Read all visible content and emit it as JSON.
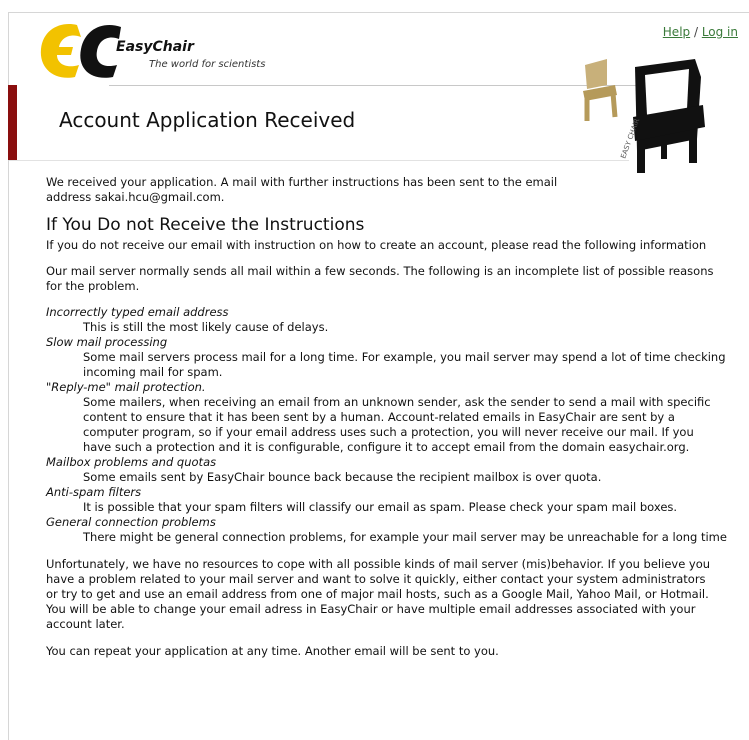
{
  "header": {
    "brand_name": "EasyChair",
    "brand_tagline": "The world for scientists",
    "help_link": "Help",
    "separator": " / ",
    "login_link": "Log in",
    "chair_caption": "EASY CHAIR"
  },
  "page": {
    "title": "Account Application Received"
  },
  "content": {
    "intro_line1": "We received your application. A mail with further instructions has been sent to the email",
    "intro_line2": "address sakai.hcu@gmail.com.",
    "section_heading": "If You Do not Receive the Instructions",
    "section_intro": "If you do not receive our email with instruction on how to create an account, please read the following information",
    "server_line1": "Our mail server normally sends all mail within a few seconds. The following is an incomplete list of possible reasons",
    "server_line2": "for the problem.",
    "reasons": [
      {
        "term": "Incorrectly typed email address",
        "lines": [
          "This is still the most likely cause of delays."
        ]
      },
      {
        "term": "Slow mail processing",
        "lines": [
          "Some mail servers process mail for a long time. For example, you mail server may spend a lot of time checking",
          "incoming mail for spam."
        ]
      },
      {
        "term": "\"Reply-me\" mail protection.",
        "lines": [
          "Some mailers, when receiving an email from an unknown sender, ask the sender to send a mail with specific",
          "content to ensure that it has been sent by a human. Account-related emails in EasyChair are sent by a",
          "computer program, so if your email address uses such a protection, you will never receive our mail. If you",
          "have such a protection and it is configurable, configure it to accept email from the domain easychair.org."
        ]
      },
      {
        "term": "Mailbox problems and quotas",
        "lines": [
          "Some emails sent by EasyChair bounce back because the recipient mailbox is over quota."
        ]
      },
      {
        "term": "Anti-spam filters",
        "lines": [
          "It is possible that your spam filters will classify our email as spam. Please check your spam mail boxes."
        ]
      },
      {
        "term": "General connection problems",
        "lines": [
          "There might be general connection problems, for example your mail server may be unreachable for a long time"
        ]
      }
    ],
    "unfortunately_lines": [
      "Unfortunately, we have no resources to cope with all possible kinds of mail server (mis)behavior. If you believe you",
      "have a problem related to your mail server and want to solve it quickly, either contact your system administrators",
      "or try to get and use an email address from one of major mail hosts, such as a Google Mail, Yahoo Mail, or Hotmail.",
      "You will be able to change your email adress in EasyChair or have multiple email addresses associated with your",
      "account later."
    ],
    "repeat_line": "You can repeat your application at any time. Another email will be sent to you."
  },
  "colors": {
    "accent": "#8a0e0e",
    "logo_yellow": "#f2c200",
    "link_green": "#3a7a3a"
  }
}
